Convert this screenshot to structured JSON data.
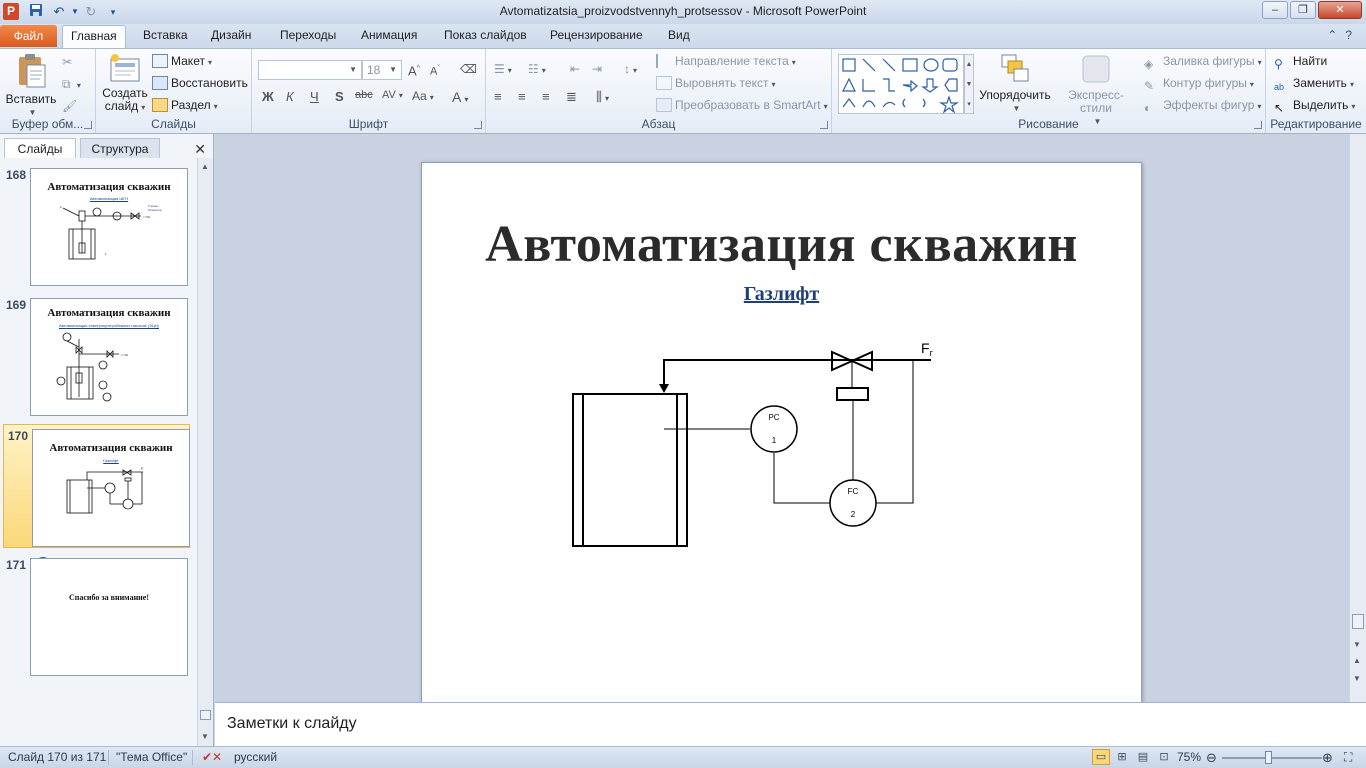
{
  "window": {
    "title": "Avtomatizatsia_proizvodstvennyh_protsessov  -  Microsoft PowerPoint",
    "app_letter": "P",
    "minimize": "–",
    "maximize": "❐",
    "close": "✕"
  },
  "tabs": {
    "file": "Файл",
    "items": [
      "Главная",
      "Вставка",
      "Дизайн",
      "Переходы",
      "Анимация",
      "Показ слайдов",
      "Рецензирование",
      "Вид"
    ]
  },
  "ribbon": {
    "clipboard": {
      "label": "Буфер обм...",
      "paste": "Вставить"
    },
    "slides": {
      "label": "Слайды",
      "new_slide_1": "Создать",
      "new_slide_2": "слайд",
      "layout": "Макет",
      "reset": "Восстановить",
      "section": "Раздел"
    },
    "font": {
      "label": "Шрифт",
      "font_name": "",
      "font_size": "18",
      "bold": "Ж",
      "italic": "К",
      "underline": "Ч",
      "shadow": "S",
      "strike": "abc",
      "spacing": "AV",
      "case": "Aa",
      "color": "A",
      "grow": "A",
      "shrink": "A"
    },
    "paragraph": {
      "label": "Абзац",
      "text_direction": "Направление текста",
      "align_text": "Выровнять текст",
      "smartart": "Преобразовать в SmartArt"
    },
    "drawing": {
      "label": "Рисование",
      "arrange": "Упорядочить",
      "quick_styles": "Экспресс-стили",
      "shape_fill": "Заливка фигуры",
      "shape_outline": "Контур фигуры",
      "shape_effects": "Эффекты фигур"
    },
    "editing": {
      "label": "Редактирование",
      "find": "Найти",
      "replace": "Заменить",
      "select": "Выделить"
    }
  },
  "left_pane": {
    "tab_slides": "Слайды",
    "tab_outline": "Структура",
    "thumbnails": [
      {
        "number": "168",
        "title": "Автоматизация скважин",
        "subtitle": "Автоматизация ШГН"
      },
      {
        "number": "169",
        "title": "Автоматизация скважин",
        "subtitle": "Автоматизация электроцентробежных насосов (ЭЦН)"
      },
      {
        "number": "170",
        "title": "Автоматизация скважин",
        "subtitle": "Газлифт"
      },
      {
        "number": "171",
        "title": "Спасибо за внимание!",
        "subtitle": ""
      }
    ]
  },
  "slide": {
    "title": "Автоматизация скважин",
    "subtitle": "Газлифт",
    "diagram": {
      "pc_label": "PC",
      "pc_num": "1",
      "fc_label": "FC",
      "fc_num": "2",
      "flow_label": "F",
      "flow_sub": "г"
    }
  },
  "notes": {
    "placeholder": "Заметки к слайду"
  },
  "status": {
    "slide_counter": "Слайд 170 из 171",
    "theme": "\"Тема Office\"",
    "language": "русский",
    "zoom": "75%",
    "zoom_fraction": 0.46
  }
}
